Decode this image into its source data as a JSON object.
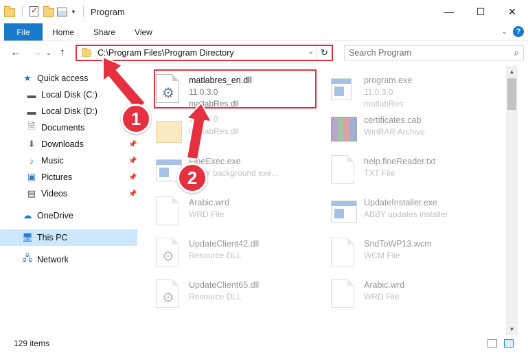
{
  "window": {
    "title": "Program",
    "controls": {
      "minimize": "—",
      "maximize": "☐",
      "close": "✕"
    }
  },
  "ribbon": {
    "file_tab": "File",
    "tabs": [
      "Home",
      "Share",
      "View"
    ],
    "help": "?"
  },
  "nav": {
    "back": "←",
    "forward": "→",
    "recent": "⌄",
    "up": "↑",
    "address": "C:\\Program Files\\Program Directory",
    "refresh": "↻",
    "search_placeholder": "Search Program"
  },
  "sidebar": {
    "items": [
      {
        "label": "Quick access",
        "icon": "star-icon",
        "glyph": "★",
        "color": "#1979ca"
      },
      {
        "label": "Local Disk (C:)",
        "icon": "drive-icon",
        "glyph": "▬",
        "color": "#555555"
      },
      {
        "label": "Local Disk (D:)",
        "icon": "drive-icon",
        "glyph": "▬",
        "color": "#555555"
      },
      {
        "label": "Documents",
        "icon": "documents-icon",
        "glyph": "🗎",
        "color": "#4b6ea8"
      },
      {
        "label": "Downloads",
        "icon": "download-icon",
        "glyph": "⬇",
        "color": "#2a7bd3"
      },
      {
        "label": "Music",
        "icon": "music-icon",
        "glyph": "♪",
        "color": "#2a7bd3"
      },
      {
        "label": "Pictures",
        "icon": "pictures-icon",
        "glyph": "▣",
        "color": "#3a78c6"
      },
      {
        "label": "Videos",
        "icon": "videos-icon",
        "glyph": "▤",
        "color": "#555555"
      },
      {
        "label": "OneDrive",
        "icon": "cloud-icon",
        "glyph": "☁",
        "color": "#1979ca"
      },
      {
        "label": "This PC",
        "icon": "computer-icon",
        "glyph": "🖥",
        "color": "#2a7bd3"
      },
      {
        "label": "Network",
        "icon": "network-icon",
        "glyph": "🖧",
        "color": "#2a7bd3"
      }
    ],
    "pin_glyph": "📌"
  },
  "files": [
    {
      "name": "matlabres_en.dll",
      "line1": "11.0.3.0",
      "line2": "matlabRes.dll",
      "icon": "dll-gear-icon"
    },
    {
      "name": "program.exe",
      "line1": "11.0.3.0",
      "line2": "matlabRes",
      "icon": "exe-icon"
    },
    {
      "name": "",
      "line1": "11.0.3.0",
      "line2": "matlabRes.dll",
      "icon": "folder-icon"
    },
    {
      "name": "certificates.cab",
      "line1": "WinRAR Archive",
      "line2": "",
      "icon": "rar-archive-icon"
    },
    {
      "name": "FineExec.exe",
      "line1": "ABBY background exe...",
      "line2": "",
      "icon": "exe-icon"
    },
    {
      "name": "help.fineReader.txt",
      "line1": "TXT File",
      "line2": "",
      "icon": "text-file-icon"
    },
    {
      "name": "Arabic.wrd",
      "line1": "WRD File",
      "line2": "",
      "icon": "file-icon"
    },
    {
      "name": "UpdateInstaller.exe",
      "line1": "ABBY updates installer",
      "line2": "",
      "icon": "exe-icon"
    },
    {
      "name": "UpdateClient42.dll",
      "line1": "Resource DLL",
      "line2": "",
      "icon": "dll-gear-icon"
    },
    {
      "name": "SndToWP13.wcm",
      "line1": "WCM File",
      "line2": "",
      "icon": "file-icon"
    },
    {
      "name": "UpdateClient65.dll",
      "line1": "Resource DLL",
      "line2": "",
      "icon": "dll-gear-icon"
    },
    {
      "name": "Arabic.wrd",
      "line1": "WRD File",
      "line2": "",
      "icon": "file-icon"
    }
  ],
  "callouts": [
    "1",
    "2"
  ],
  "status": {
    "count": "129 items"
  },
  "colors": {
    "accent": "#1979ca",
    "highlight": "#e53040",
    "selected": "#cce8ff"
  }
}
